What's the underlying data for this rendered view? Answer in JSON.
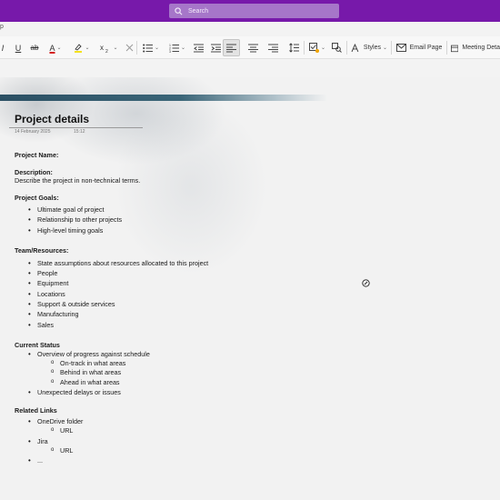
{
  "titlebar": {
    "search_placeholder": "Search",
    "color": "#7719aa"
  },
  "tabbar": {
    "partial_tab": "p"
  },
  "ribbon": {
    "email_page_label": "Email Page",
    "meeting_details_label": "Meeting Deta",
    "styles_label": "Styles",
    "underline_label": "U",
    "strike_label": "ab",
    "font_color_label": "A",
    "highlight_color": "#f4e11c",
    "font_color": "#d42020"
  },
  "page": {
    "title": "Project details",
    "date": "14 February 2025",
    "time": "15:12",
    "sections": {
      "project_name": "Project Name:",
      "description_heading": "Description:",
      "description_text": "Describe the project in non-technical terms.",
      "goals_heading": "Project Goals:",
      "goals": [
        "Ultimate goal of project",
        "Relationship to other projects",
        "High-level timing goals"
      ],
      "team_heading": "Team/Resources:",
      "team": [
        "State assumptions about resources allocated to this project",
        "People",
        "Equipment",
        "Locations",
        "Support & outside services",
        "Manufacturing",
        "Sales"
      ],
      "status_heading": "Current Status",
      "status_item_1": "Overview of progress against schedule",
      "status_sub": [
        "On-track in what areas",
        "Behind in what areas",
        "Ahead in what areas"
      ],
      "status_item_2": "Unexpected delays or issues",
      "links_heading": "Related Links",
      "link_1": "OneDrive folder",
      "link_1_sub": "URL",
      "link_2": "Jira",
      "link_2_sub": "URL",
      "link_3": "..."
    }
  }
}
